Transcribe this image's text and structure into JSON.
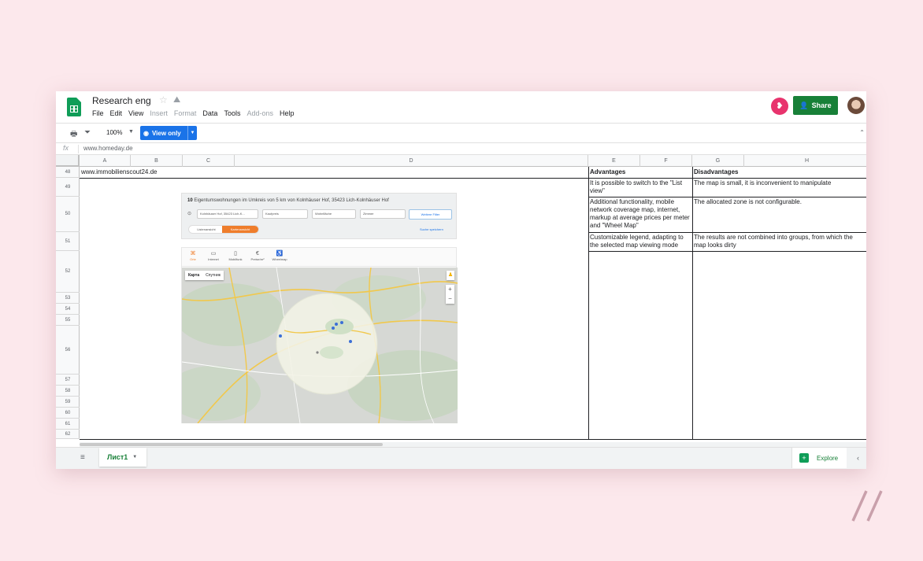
{
  "app": {
    "doc_title": "Research eng",
    "menu": [
      "File",
      "Edit",
      "View",
      "Insert",
      "Format",
      "Data",
      "Tools",
      "Add-ons",
      "Help"
    ],
    "menu_disabled": [
      "Insert",
      "Format",
      "Add-ons"
    ],
    "share_label": "Share",
    "accent": "#188038"
  },
  "toolbar": {
    "zoom": "100%",
    "view_only_label": "View only"
  },
  "formula": {
    "fx": "fx",
    "value": "www.homeday.de"
  },
  "columns": [
    "A",
    "B",
    "C",
    "D",
    "E",
    "F",
    "G",
    "H"
  ],
  "rows": [
    "48",
    "49",
    "50",
    "51",
    "52",
    "53",
    "54",
    "55",
    "56",
    "57",
    "58",
    "59",
    "60",
    "61",
    "62"
  ],
  "cells": {
    "a48": "www.immobilienscout24.de",
    "e48": "Advantages",
    "g48": "Disadvantages",
    "e49": "It is possible to switch to the \"List view\"",
    "g49": "The map is small, it is inconvenient to manipulate",
    "e50": "Additional functionality, mobile network coverage map, internet, markup at average prices per meter and \"Wheel Map\"",
    "g50": "The allocated zone is not configurable.",
    "e51": "Customizable legend, adapting to the selected map viewing mode",
    "g51": "The results are not combined into groups, from which the map looks dirty"
  },
  "embed": {
    "count": "10",
    "title": "Eigentumswohnungen im Umkreis von 5 km von Kolnhäuser Hof, 35423 Lich-Kolnhäuser Hof",
    "selects": [
      "Kolnhäuser Hof, 35423 Lich-K...",
      "Kaufpreis",
      "Wohnfläche",
      "Zimmer"
    ],
    "more_filters": "Weitere Filter",
    "list_view": "Listenansicht",
    "map_view": "Kartenansicht",
    "save_search": "Suche speichern",
    "map_tabs": [
      "Orte",
      "Internet",
      "Mobilfunk",
      "Preise/m²",
      "Wheelmap"
    ],
    "map_types": [
      "Карта",
      "Спутник"
    ]
  },
  "sheetbar": {
    "sheet_name": "Лист1",
    "explore_label": "Explore"
  }
}
